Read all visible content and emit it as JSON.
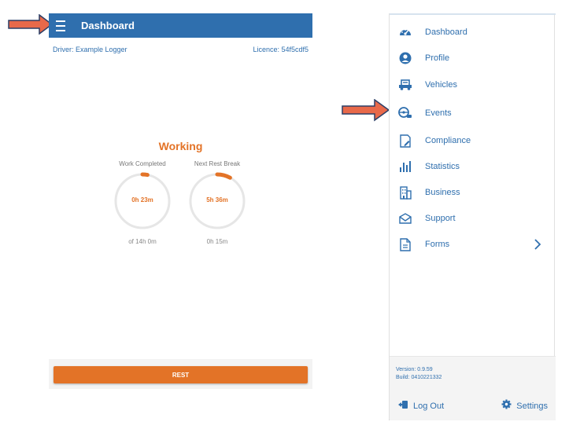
{
  "colors": {
    "primary": "#2f6fae",
    "accent": "#e37327",
    "arrow": "#e8694a"
  },
  "app_bar": {
    "title": "Dashboard",
    "menu_icon": "hamburger-menu-icon"
  },
  "driver": {
    "name": "Driver: Example Logger",
    "licence": "Licence: 54f5cdf5"
  },
  "status": {
    "title": "Working"
  },
  "gauges": [
    {
      "label": "Work Completed",
      "value": "0h 23m",
      "sub": "of 14h 0m",
      "progress": 0.03
    },
    {
      "label": "Next Rest Break",
      "value": "5h 36m",
      "sub": "0h 15m",
      "progress": 0.08
    }
  ],
  "rest_button": {
    "label": "REST"
  },
  "drawer": {
    "items": [
      {
        "label": "Dashboard",
        "icon": "speedometer-icon"
      },
      {
        "label": "Profile",
        "icon": "user-circle-icon"
      },
      {
        "label": "Vehicles",
        "icon": "truck-icon"
      },
      {
        "label": "Events",
        "icon": "steering-wheel-icon"
      },
      {
        "label": "Compliance",
        "icon": "document-edit-icon"
      },
      {
        "label": "Statistics",
        "icon": "bar-chart-icon"
      },
      {
        "label": "Business",
        "icon": "building-icon"
      },
      {
        "label": "Support",
        "icon": "envelope-icon"
      },
      {
        "label": "Forms",
        "icon": "file-icon"
      }
    ],
    "version": "Version: 0.9.59",
    "build": "Build: 0410221332",
    "logout_label": "Log Out",
    "settings_label": "Settings"
  }
}
